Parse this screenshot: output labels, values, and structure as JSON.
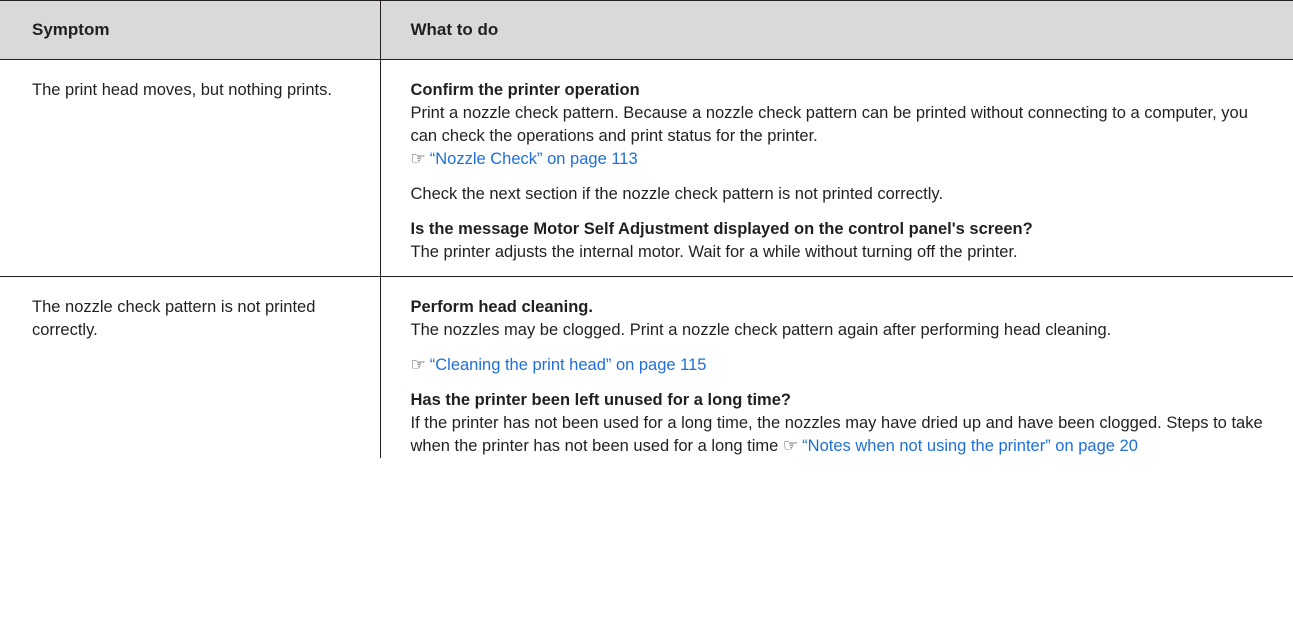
{
  "header": {
    "symptom": "Symptom",
    "what_to_do": "What to do"
  },
  "rows": [
    {
      "symptom": "The print head moves, but nothing prints.",
      "blocks": [
        {
          "heading": "Confirm the printer operation",
          "text": "Print a nozzle check pattern. Because a nozzle check pattern can be printed without connecting to a computer, you can check the operations and print status for the printer.",
          "ref_icon": "☞",
          "ref_link": "“Nozzle Check” on page 113"
        },
        {
          "text": "Check the next section if the nozzle check pattern is not printed correctly."
        },
        {
          "heading": "Is the message Motor Self Adjustment displayed on the control panel's screen?",
          "text": "The printer adjusts the internal motor. Wait for a while without turning off the printer."
        }
      ]
    },
    {
      "symptom": "The nozzle check pattern is not printed correctly.",
      "blocks": [
        {
          "heading": "Perform head cleaning.",
          "text": "The nozzles may be clogged. Print a nozzle check pattern again after performing head cleaning."
        },
        {
          "ref_icon": "☞",
          "ref_link": "“Cleaning the print head” on page 115"
        },
        {
          "heading": "Has the printer been left unused for a long time?",
          "text": "If the printer has not been used for a long time, the nozzles may have dried up and have been clogged. Steps to take when the printer has not been used for a long time",
          "ref_icon": "☞",
          "ref_link": "“Notes when not using the printer” on page 20"
        }
      ]
    }
  ],
  "colors": {
    "header_bg": "#d9d9d9",
    "text": "#231f20",
    "link": "#1e6fd9",
    "border": "#231f20"
  }
}
